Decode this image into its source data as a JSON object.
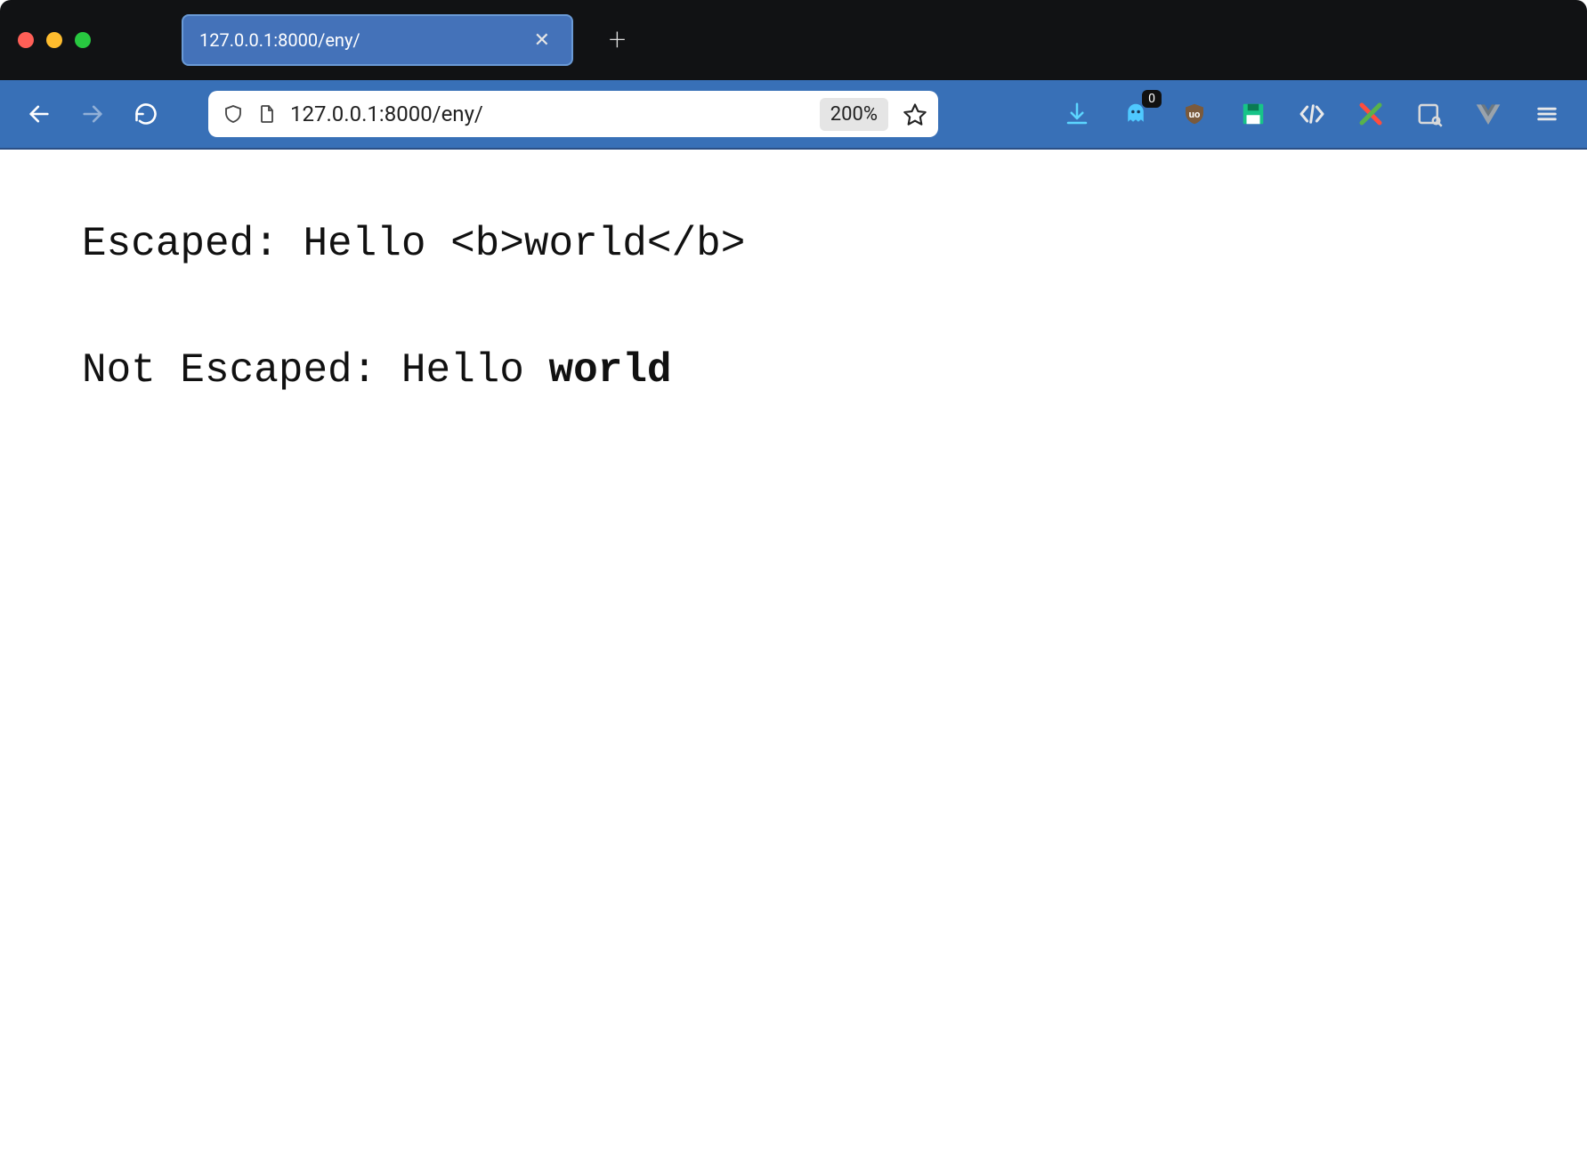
{
  "tab": {
    "title": "127.0.0.1:8000/eny/"
  },
  "urlbar": {
    "url": "127.0.0.1:8000/eny/",
    "zoom": "200%"
  },
  "extensions": {
    "ghost_badge": "0"
  },
  "page": {
    "escaped_label": "Escaped: ",
    "escaped_value": "Hello <b>world</b>",
    "not_escaped_label": "Not Escaped: ",
    "not_escaped_prefix": "Hello ",
    "not_escaped_bold": "world"
  }
}
